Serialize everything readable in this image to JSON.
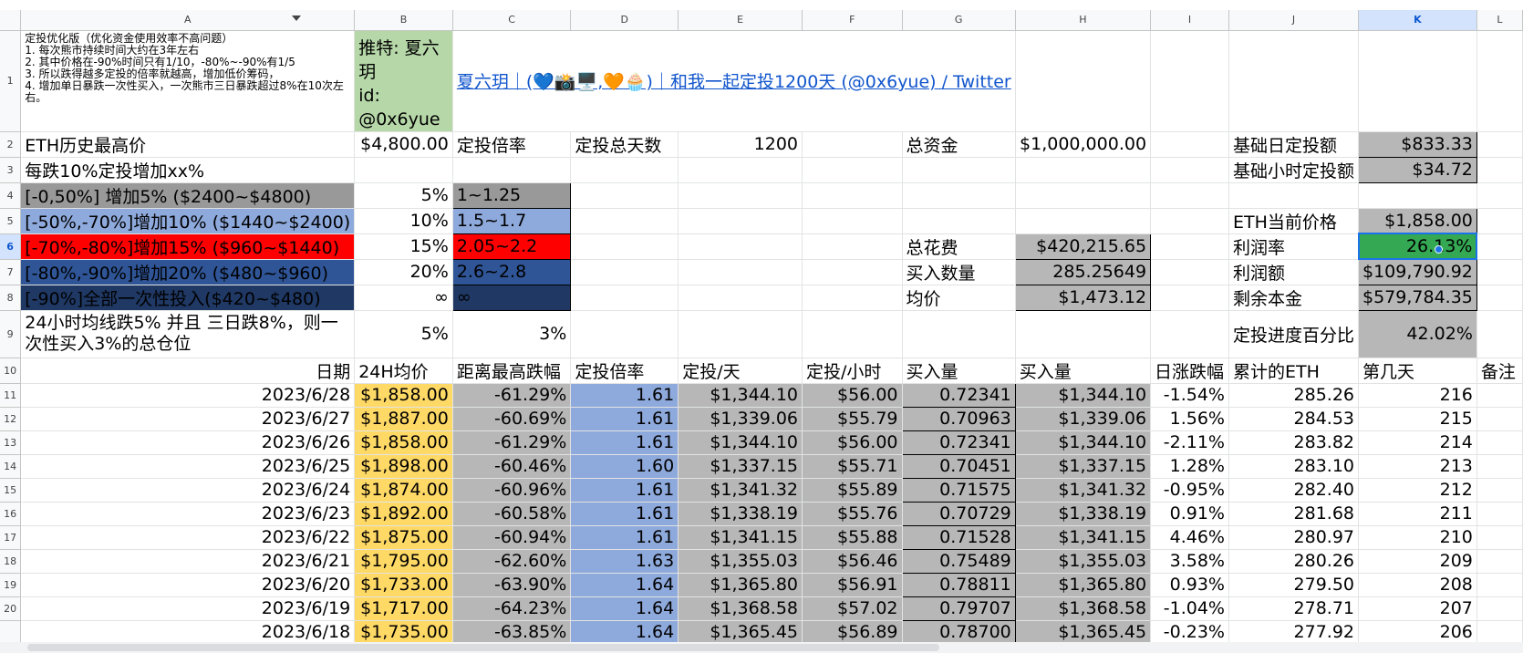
{
  "columns": [
    "A",
    "B",
    "C",
    "D",
    "E",
    "F",
    "G",
    "H",
    "I",
    "J",
    "K",
    "L"
  ],
  "rows_header": [
    "1",
    "2",
    "3",
    "4",
    "5",
    "6",
    "7",
    "8",
    "9",
    "10",
    "11",
    "12",
    "13",
    "14",
    "15",
    "16",
    "17",
    "18",
    "19",
    "20",
    ""
  ],
  "r1": {
    "a": "定投优化版（优化资金使用效率不高问题）\n1. 每次熊市持续时间大约在3年左右\n2. 其中价格在-90%时间只有1/10，-80%~-90%有1/5\n3. 所以跌得越多定投的倍率就越高，增加低价筹码，\n4. 增加单日暴跌一次性买入，一次熊市三日暴跌超过8%在10次左右。",
    "b": "推特: 夏六玥\nid: @0x6yue",
    "link": "夏六玥｜(💙📸🖥️,🧡🧁)｜和我一起定投1200天 (@0x6yue) / Twitter"
  },
  "r2": {
    "a": "ETH历史最高价",
    "b": "$4,800.00",
    "c": "定投倍率",
    "d": "定投总天数",
    "e": "1200",
    "g": "总资金",
    "h": "$1,000,000.00",
    "j": "基础日定投额",
    "k": "$833.33"
  },
  "r3": {
    "a": "每跌10%定投增加xx%",
    "j": "基础小时定投额",
    "k": "$34.72"
  },
  "r4": {
    "a": "[-0,50%] 增加5% ($2400~$4800)",
    "b": "5%",
    "c": "1~1.25"
  },
  "r5": {
    "a": "[-50%,-70%]增加10% ($1440~$2400)",
    "b": "10%",
    "c": "1.5~1.7",
    "j": "ETH当前价格",
    "k": "$1,858.00"
  },
  "r6": {
    "a": "[-70%,-80%]增加15% ($960~$1440)",
    "b": "15%",
    "c": "2.05~2.2",
    "g": "总花费",
    "h": "$420,215.65",
    "j": "利润率",
    "k": "26.13%"
  },
  "r7": {
    "a": "[-80%,-90%]增加20% ($480~$960)",
    "b": "20%",
    "c": "2.6~2.8",
    "g": "买入数量",
    "h": "285.25649",
    "j": "利润额",
    "k": "$109,790.92"
  },
  "r8": {
    "a": "[-90%]全部一次性投入($420~$480)",
    "b": "∞",
    "c": "∞",
    "g": "均价",
    "h": "$1,473.12",
    "j": "剩余本金",
    "k": "$579,784.35"
  },
  "r9": {
    "a": "24小时均线跌5% 并且 三日跌8%，则一次性买入3%的总仓位",
    "b": "5%",
    "c": "3%",
    "j": "定投进度百分比",
    "k": "42.02%"
  },
  "header10": [
    "日期",
    "24H均价",
    "距离最高跌幅",
    "定投倍率",
    "定投/天",
    "定投/小时",
    "买入量",
    "买入量",
    "日涨跌幅",
    "累计的ETH",
    "第几天",
    "备注"
  ],
  "data_rows": [
    [
      "2023/6/28",
      "$1,858.00",
      "-61.29%",
      "1.61",
      "$1,344.10",
      "$56.00",
      "0.72341",
      "$1,344.10",
      "-1.54%",
      "285.26",
      "216"
    ],
    [
      "2023/6/27",
      "$1,887.00",
      "-60.69%",
      "1.61",
      "$1,339.06",
      "$55.79",
      "0.70963",
      "$1,339.06",
      "1.56%",
      "284.53",
      "215"
    ],
    [
      "2023/6/26",
      "$1,858.00",
      "-61.29%",
      "1.61",
      "$1,344.10",
      "$56.00",
      "0.72341",
      "$1,344.10",
      "-2.11%",
      "283.82",
      "214"
    ],
    [
      "2023/6/25",
      "$1,898.00",
      "-60.46%",
      "1.60",
      "$1,337.15",
      "$55.71",
      "0.70451",
      "$1,337.15",
      "1.28%",
      "283.10",
      "213"
    ],
    [
      "2023/6/24",
      "$1,874.00",
      "-60.96%",
      "1.61",
      "$1,341.32",
      "$55.89",
      "0.71575",
      "$1,341.32",
      "-0.95%",
      "282.40",
      "212"
    ],
    [
      "2023/6/23",
      "$1,892.00",
      "-60.58%",
      "1.61",
      "$1,338.19",
      "$55.76",
      "0.70729",
      "$1,338.19",
      "0.91%",
      "281.68",
      "211"
    ],
    [
      "2023/6/22",
      "$1,875.00",
      "-60.94%",
      "1.61",
      "$1,341.15",
      "$55.88",
      "0.71528",
      "$1,341.15",
      "4.46%",
      "280.97",
      "210"
    ],
    [
      "2023/6/21",
      "$1,795.00",
      "-62.60%",
      "1.63",
      "$1,355.03",
      "$56.46",
      "0.75489",
      "$1,355.03",
      "3.58%",
      "280.26",
      "209"
    ],
    [
      "2023/6/20",
      "$1,733.00",
      "-63.90%",
      "1.64",
      "$1,365.80",
      "$56.91",
      "0.78811",
      "$1,365.80",
      "0.93%",
      "279.50",
      "208"
    ],
    [
      "2023/6/19",
      "$1,717.00",
      "-64.23%",
      "1.64",
      "$1,368.58",
      "$57.02",
      "0.79707",
      "$1,368.58",
      "-1.04%",
      "278.71",
      "207"
    ],
    [
      "2023/6/18",
      "$1,735.00",
      "-63.85%",
      "1.64",
      "$1,365.45",
      "$56.89",
      "0.78700",
      "$1,365.45",
      "-0.23%",
      "277.92",
      "206"
    ]
  ]
}
